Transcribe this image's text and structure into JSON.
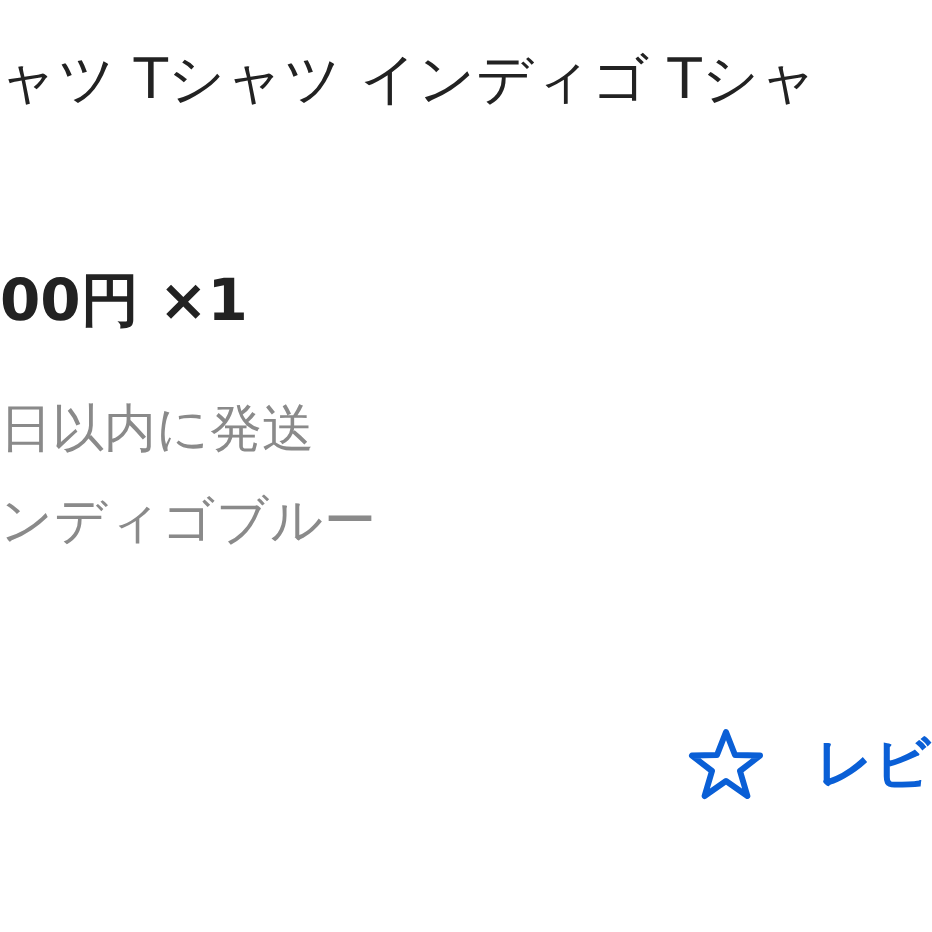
{
  "product": {
    "title": "ャツ Tシャツ インディゴ Tシャ",
    "price": "00円 ×1",
    "shipping": "日以内に発送",
    "variant": "ンディゴブルー"
  },
  "review_button": {
    "label": "レビ"
  }
}
